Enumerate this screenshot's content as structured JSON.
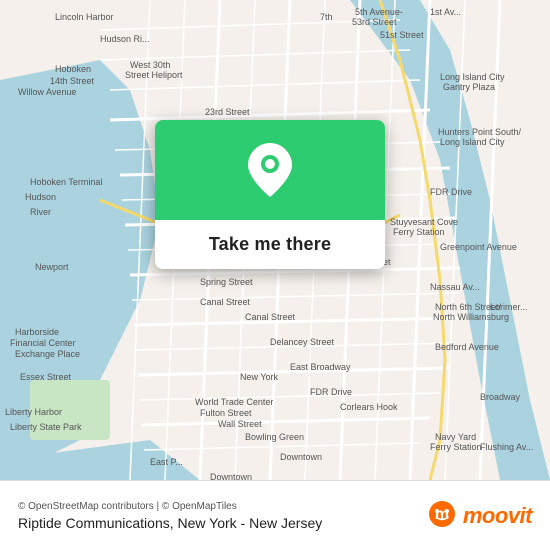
{
  "map": {
    "attribution": "© OpenStreetMap contributors | © OpenMapTiles",
    "location_name": "Riptide Communications, New York - New Jersey",
    "popup_button_label": "Take me there"
  },
  "moovit": {
    "wordmark": "moovit",
    "icon_color": "#ff6900"
  },
  "colors": {
    "water": "#aad3df",
    "land": "#f5f0eb",
    "park": "#c8e6c4",
    "green_popup": "#2ecc71",
    "street_yellow": "#f6d96b"
  }
}
